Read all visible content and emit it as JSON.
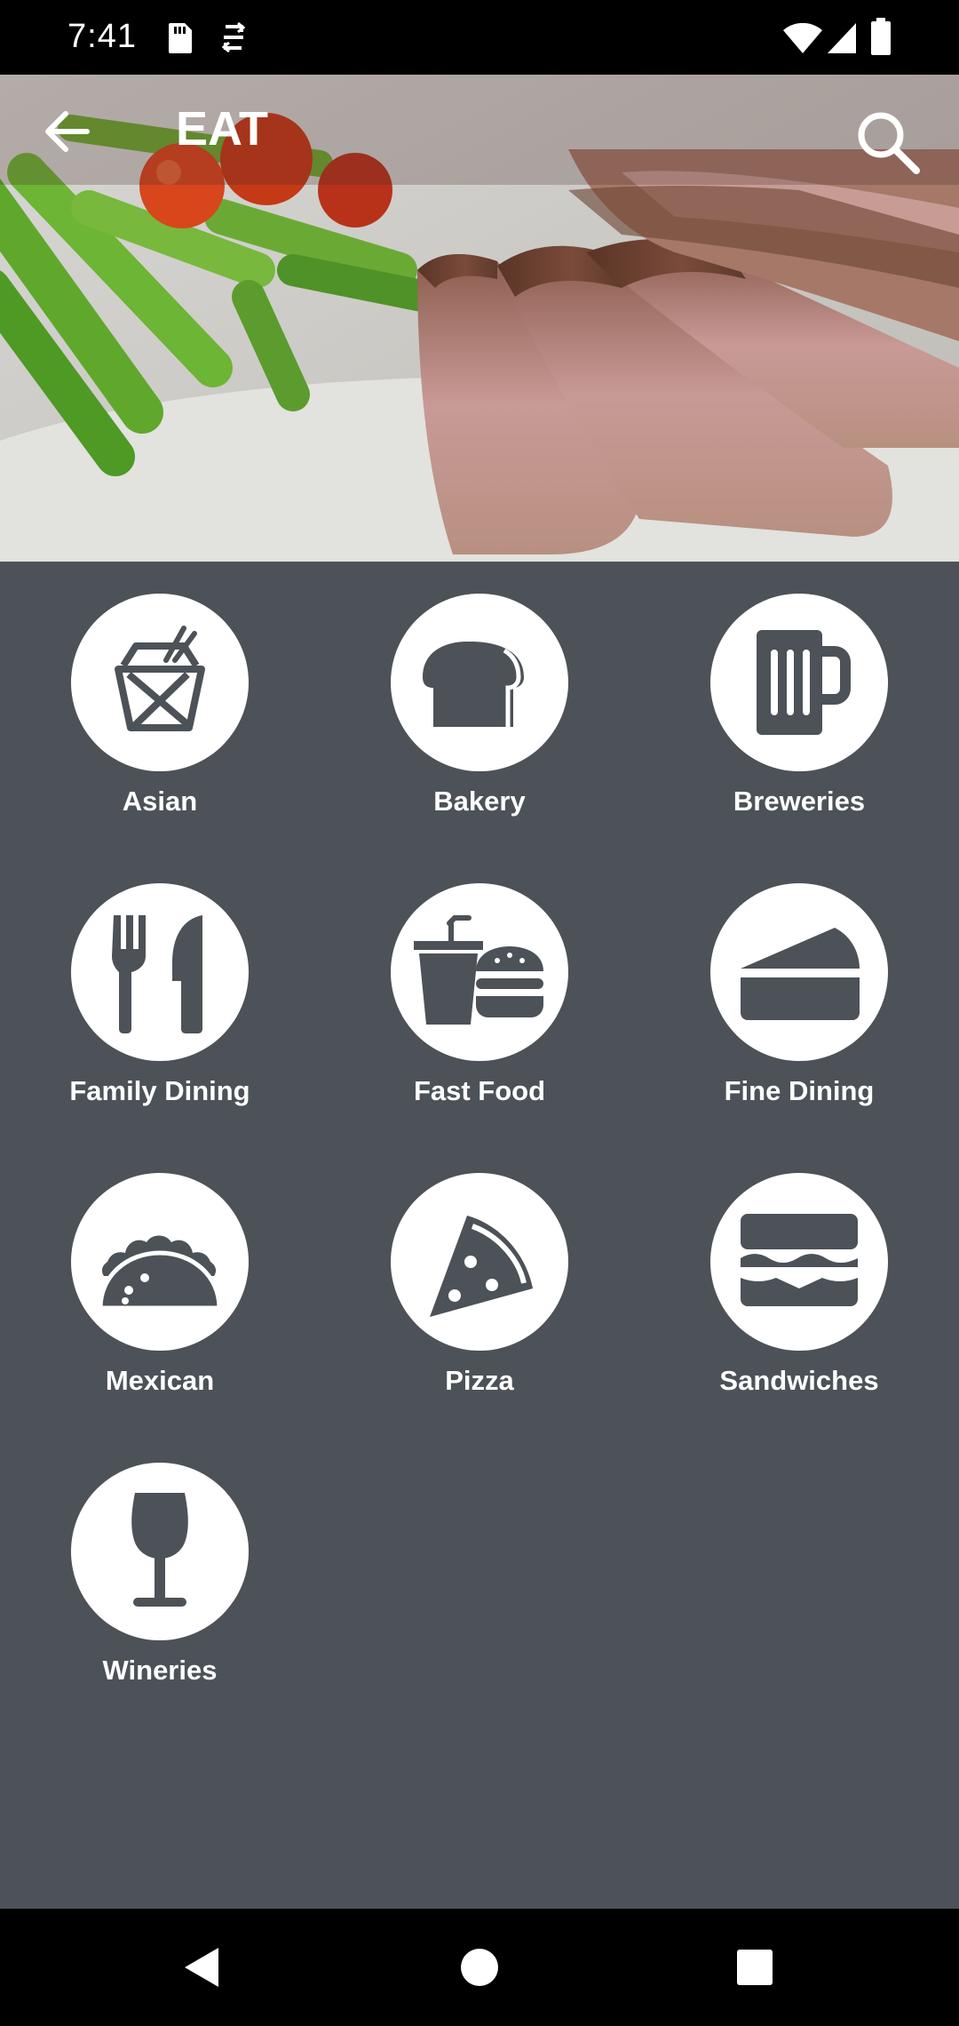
{
  "status_bar": {
    "time": "7:41",
    "left_icons": [
      "sd-card-icon",
      "sync-icon"
    ],
    "right_icons": [
      "wifi-icon",
      "signal-icon",
      "battery-icon"
    ]
  },
  "app_bar": {
    "title": "EAT",
    "back_icon": "arrow-back-icon",
    "search_icon": "search-icon"
  },
  "hero": {
    "image": "steak-and-asparagus-photo"
  },
  "categories": [
    {
      "label": "Asian",
      "icon": "takeout-box-icon"
    },
    {
      "label": "Bakery",
      "icon": "bread-icon"
    },
    {
      "label": "Breweries",
      "icon": "beer-mug-icon"
    },
    {
      "label": "Family Dining",
      "icon": "fork-knife-icon"
    },
    {
      "label": "Fast Food",
      "icon": "burger-drink-icon"
    },
    {
      "label": "Fine Dining",
      "icon": "cake-slice-icon"
    },
    {
      "label": "Mexican",
      "icon": "taco-icon"
    },
    {
      "label": "Pizza",
      "icon": "pizza-slice-icon"
    },
    {
      "label": "Sandwiches",
      "icon": "sandwich-icon"
    },
    {
      "label": "Wineries",
      "icon": "wine-glass-icon"
    }
  ],
  "colors": {
    "background": "#4c5257",
    "icon_fill": "#4c5257",
    "circle": "#ffffff",
    "text": "#ffffff"
  },
  "nav_bar": {
    "back_icon": "nav-back-icon",
    "home_icon": "nav-home-icon",
    "recents_icon": "nav-recents-icon"
  }
}
